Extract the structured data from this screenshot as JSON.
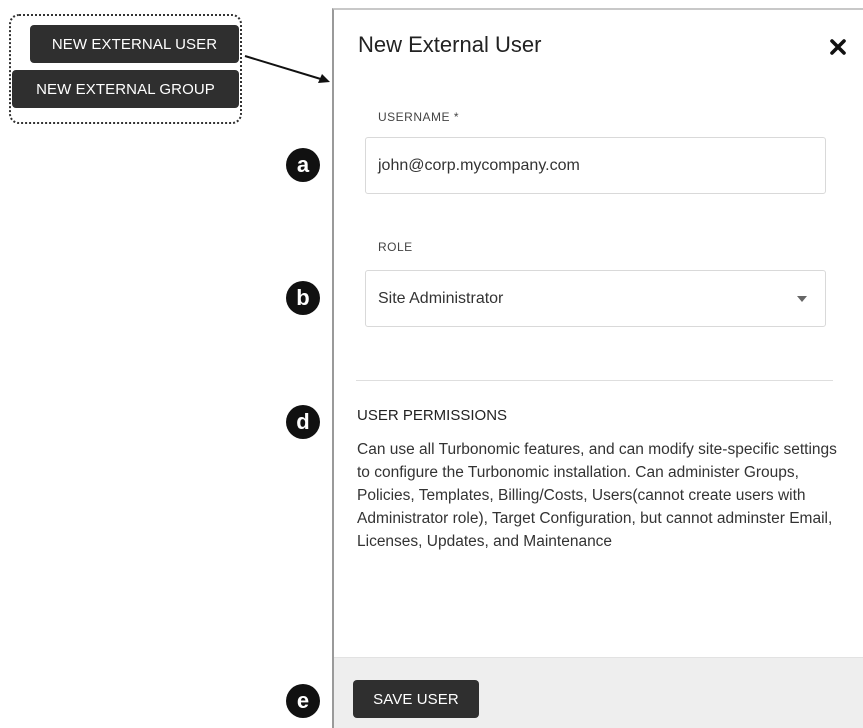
{
  "callout": {
    "new_external_user_label": "NEW EXTERNAL USER",
    "new_external_group_label": "NEW EXTERNAL GROUP"
  },
  "dialog": {
    "title": "New External User",
    "close_icon": "close-icon",
    "username": {
      "label": "USERNAME *",
      "value": "john@corp.mycompany.com"
    },
    "role": {
      "label": "ROLE",
      "selected": "Site Administrator"
    },
    "permissions": {
      "title": "USER PERMISSIONS",
      "description": "Can use all Turbonomic features, and can modify site-specific settings to configure the Turbonomic installation. Can administer Groups, Policies, Templates, Billing/Costs, Users(cannot create users with Administrator role), Target Configuration, but cannot adminster Email, Licenses, Updates, and Maintenance"
    },
    "footer": {
      "save_label": "SAVE USER"
    }
  },
  "markers": {
    "a": "a",
    "b": "b",
    "d": "d",
    "e": "e"
  },
  "colors": {
    "button_bg": "#2f2f2f",
    "footer_bg": "#eeeeee",
    "marker_bg": "#111111"
  }
}
